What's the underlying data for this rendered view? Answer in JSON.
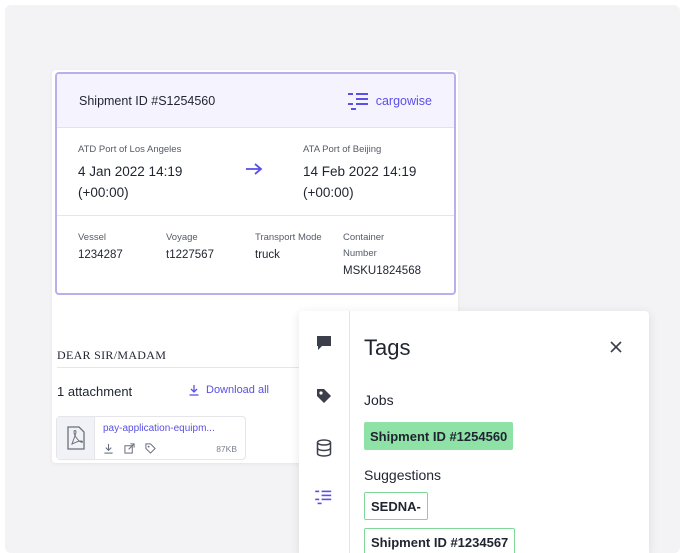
{
  "shipment": {
    "title": "Shipment ID #S1254560",
    "brand": "cargowise",
    "departure": {
      "label": "ATD Port of Los Angeles",
      "time": "4 Jan 2022 14:19 (+00:00)"
    },
    "arrival": {
      "label": "ATA Port of Beijing",
      "time": "14 Feb 2022 14:19 (+00:00)"
    },
    "details": [
      {
        "label": "Vessel",
        "value": "1234287"
      },
      {
        "label": "Voyage",
        "value": "t1227567"
      },
      {
        "label": "Transport Mode",
        "value": "truck"
      },
      {
        "label": "Container Number",
        "value": "MSKU1824568"
      }
    ]
  },
  "email": {
    "salutation": "DEAR SIR/MADAM",
    "attachments_count": "1 attachment",
    "download_all": "Download all",
    "file": {
      "name": "pay-application-equipm...",
      "size": "87KB"
    }
  },
  "tags": {
    "title": "Tags",
    "jobs_label": "Jobs",
    "jobs": [
      "Shipment ID #1254560"
    ],
    "suggestions_label": "Suggestions",
    "suggestions": [
      "SEDNA-",
      "Shipment ID #1234567"
    ]
  },
  "icons": {
    "rail": [
      "comment-icon",
      "tag-icon",
      "database-icon",
      "cargowise-icon"
    ],
    "close": "close-icon",
    "arrow": "arrow-right-icon",
    "download": "download-icon",
    "pdf": "pdf-file-icon"
  },
  "colors": {
    "accent": "#5a50e6",
    "card_border": "#b7b0ef",
    "header_bg": "#f5f4fe",
    "tag_green": "#8fe2a6",
    "tag_border": "#7fd89a"
  }
}
